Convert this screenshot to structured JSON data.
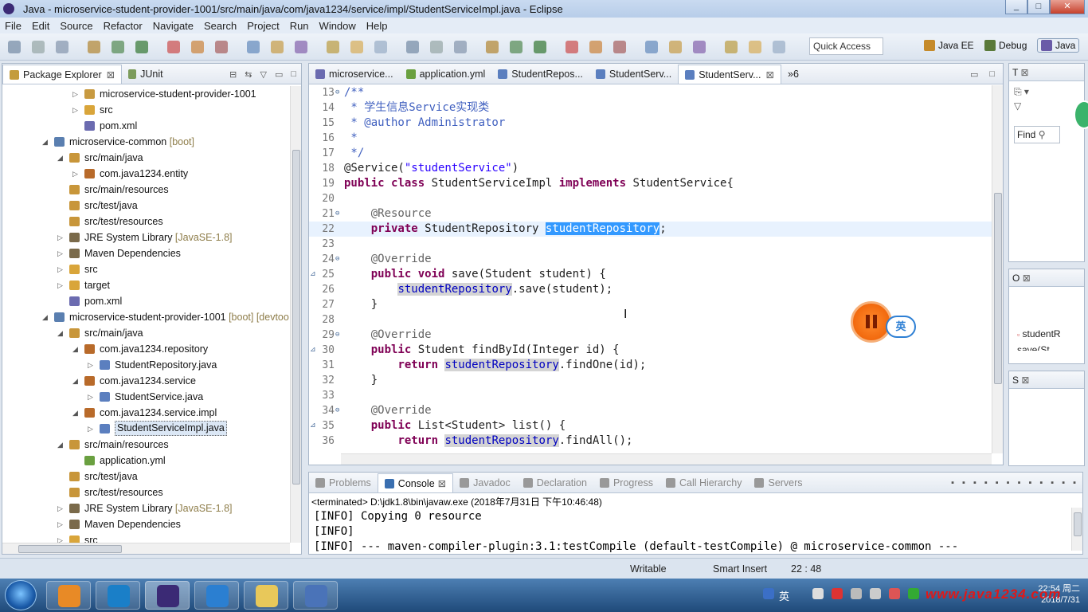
{
  "window": {
    "title": "Java - microservice-student-provider-1001/src/main/java/com/java1234/service/impl/StudentServiceImpl.java - Eclipse",
    "app_icon": "eclipse-icon"
  },
  "menu": [
    "File",
    "Edit",
    "Source",
    "Refactor",
    "Navigate",
    "Search",
    "Project",
    "Run",
    "Window",
    "Help"
  ],
  "toolbar": {
    "quick_access": "Quick Access",
    "perspectives": [
      {
        "label": "Java EE",
        "icon": "java-ee-icon"
      },
      {
        "label": "Debug",
        "icon": "debug-icon"
      },
      {
        "label": "Java",
        "icon": "java-perspective-icon",
        "active": true
      }
    ]
  },
  "package_explorer": {
    "tabs": [
      {
        "label": "Package Explorer",
        "active": true
      },
      {
        "label": "JUnit"
      }
    ],
    "rows": [
      {
        "indent": 3,
        "twisty": "▷",
        "icon": "package-folder",
        "text": "microservice-student-provider-1001",
        "deco": ""
      },
      {
        "indent": 3,
        "twisty": "▷",
        "icon": "folder",
        "text": "src",
        "deco": ""
      },
      {
        "indent": 3,
        "twisty": "",
        "icon": "pom",
        "text": "pom.xml",
        "deco": ""
      },
      {
        "indent": 1,
        "twisty": "◢",
        "icon": "project",
        "text": "microservice-common",
        "deco": " [boot]"
      },
      {
        "indent": 2,
        "twisty": "◢",
        "icon": "src-folder",
        "text": "src/main/java",
        "deco": ""
      },
      {
        "indent": 3,
        "twisty": "▷",
        "icon": "package",
        "text": "com.java1234.entity",
        "deco": ""
      },
      {
        "indent": 2,
        "twisty": "",
        "icon": "src-folder",
        "text": "src/main/resources",
        "deco": ""
      },
      {
        "indent": 2,
        "twisty": "",
        "icon": "src-folder",
        "text": "src/test/java",
        "deco": ""
      },
      {
        "indent": 2,
        "twisty": "",
        "icon": "src-folder",
        "text": "src/test/resources",
        "deco": ""
      },
      {
        "indent": 2,
        "twisty": "▷",
        "icon": "library",
        "text": "JRE System Library",
        "deco": " [JavaSE-1.8]"
      },
      {
        "indent": 2,
        "twisty": "▷",
        "icon": "library",
        "text": "Maven Dependencies",
        "deco": ""
      },
      {
        "indent": 2,
        "twisty": "▷",
        "icon": "folder",
        "text": "src",
        "deco": ""
      },
      {
        "indent": 2,
        "twisty": "▷",
        "icon": "folder",
        "text": "target",
        "deco": ""
      },
      {
        "indent": 2,
        "twisty": "",
        "icon": "pom",
        "text": "pom.xml",
        "deco": ""
      },
      {
        "indent": 1,
        "twisty": "◢",
        "icon": "project",
        "text": "microservice-student-provider-1001",
        "deco": " [boot] [devtoo"
      },
      {
        "indent": 2,
        "twisty": "◢",
        "icon": "src-folder",
        "text": "src/main/java",
        "deco": ""
      },
      {
        "indent": 3,
        "twisty": "◢",
        "icon": "package",
        "text": "com.java1234.repository",
        "deco": ""
      },
      {
        "indent": 4,
        "twisty": "▷",
        "icon": "java-file",
        "text": "StudentRepository.java",
        "deco": ""
      },
      {
        "indent": 3,
        "twisty": "◢",
        "icon": "package",
        "text": "com.java1234.service",
        "deco": ""
      },
      {
        "indent": 4,
        "twisty": "▷",
        "icon": "java-file",
        "text": "StudentService.java",
        "deco": ""
      },
      {
        "indent": 3,
        "twisty": "◢",
        "icon": "package",
        "text": "com.java1234.service.impl",
        "deco": ""
      },
      {
        "indent": 4,
        "twisty": "▷",
        "icon": "java-file",
        "text": "StudentServiceImpl.java",
        "deco": "",
        "selected": true
      },
      {
        "indent": 2,
        "twisty": "◢",
        "icon": "src-folder",
        "text": "src/main/resources",
        "deco": ""
      },
      {
        "indent": 3,
        "twisty": "",
        "icon": "yml",
        "text": "application.yml",
        "deco": ""
      },
      {
        "indent": 2,
        "twisty": "",
        "icon": "src-folder",
        "text": "src/test/java",
        "deco": ""
      },
      {
        "indent": 2,
        "twisty": "",
        "icon": "src-folder",
        "text": "src/test/resources",
        "deco": ""
      },
      {
        "indent": 2,
        "twisty": "▷",
        "icon": "library",
        "text": "JRE System Library",
        "deco": " [JavaSE-1.8]"
      },
      {
        "indent": 2,
        "twisty": "▷",
        "icon": "library",
        "text": "Maven Dependencies",
        "deco": ""
      },
      {
        "indent": 2,
        "twisty": "▷",
        "icon": "folder",
        "text": "src",
        "deco": ""
      }
    ]
  },
  "editor": {
    "tabs": [
      {
        "label": "microservice...",
        "icon": "pom"
      },
      {
        "label": "application.yml",
        "icon": "yml"
      },
      {
        "label": "StudentRepos...",
        "icon": "java-file"
      },
      {
        "label": "StudentServ...",
        "icon": "java-file"
      },
      {
        "label": "StudentServ...",
        "icon": "java-file",
        "active": true
      }
    ],
    "overflow": "»6",
    "lines": [
      {
        "n": "13",
        "m": "⊖",
        "parts": [
          [
            "cmt",
            "/**"
          ]
        ]
      },
      {
        "n": "14",
        "parts": [
          [
            "cmt",
            " * 学生信息Service实现类"
          ]
        ]
      },
      {
        "n": "15",
        "parts": [
          [
            "cmt",
            " * @author Administrator"
          ]
        ]
      },
      {
        "n": "16",
        "parts": [
          [
            "cmt",
            " *"
          ]
        ]
      },
      {
        "n": "17",
        "parts": [
          [
            "cmt",
            " */"
          ]
        ]
      },
      {
        "n": "18",
        "parts": [
          [
            "",
            "@Service("
          ],
          [
            "str",
            "\"studentService\""
          ],
          [
            "",
            ")"
          ]
        ]
      },
      {
        "n": "19",
        "parts": [
          [
            "kw",
            "public"
          ],
          [
            "",
            " "
          ],
          [
            "kw",
            "class"
          ],
          [
            "",
            " StudentServiceImpl "
          ],
          [
            "kw",
            "implements"
          ],
          [
            "",
            " StudentService{"
          ]
        ]
      },
      {
        "n": "20",
        "parts": [
          [
            "",
            ""
          ]
        ]
      },
      {
        "n": "21",
        "m": "⊖",
        "parts": [
          [
            "ann",
            "    @Resource"
          ]
        ]
      },
      {
        "n": "22",
        "cur": true,
        "parts": [
          [
            "",
            "    "
          ],
          [
            "kw",
            "private"
          ],
          [
            "",
            " StudentRepository "
          ],
          [
            "sel2",
            "studentRepository"
          ],
          [
            "",
            ";"
          ]
        ]
      },
      {
        "n": "23",
        "parts": [
          [
            "",
            ""
          ]
        ]
      },
      {
        "n": "24",
        "m": "⊖",
        "parts": [
          [
            "ann",
            "    @Override"
          ]
        ]
      },
      {
        "n": "25",
        "o": "⊿",
        "parts": [
          [
            "",
            "    "
          ],
          [
            "kw",
            "public"
          ],
          [
            "",
            " "
          ],
          [
            "kw",
            "void"
          ],
          [
            "",
            " save(Student student) {"
          ]
        ]
      },
      {
        "n": "26",
        "parts": [
          [
            "",
            "        "
          ],
          [
            "fld hl",
            "studentRepository"
          ],
          [
            "",
            ".save(student);"
          ]
        ]
      },
      {
        "n": "27",
        "parts": [
          [
            "",
            "    }"
          ]
        ]
      },
      {
        "n": "28",
        "parts": [
          [
            "",
            ""
          ]
        ]
      },
      {
        "n": "29",
        "m": "⊖",
        "parts": [
          [
            "ann",
            "    @Override"
          ]
        ]
      },
      {
        "n": "30",
        "o": "⊿",
        "parts": [
          [
            "",
            "    "
          ],
          [
            "kw",
            "public"
          ],
          [
            "",
            " Student findById(Integer id) {"
          ]
        ]
      },
      {
        "n": "31",
        "parts": [
          [
            "",
            "        "
          ],
          [
            "kw",
            "return"
          ],
          [
            "",
            " "
          ],
          [
            "fld hl",
            "studentRepository"
          ],
          [
            "",
            ".findOne(id);"
          ]
        ]
      },
      {
        "n": "32",
        "parts": [
          [
            "",
            "    }"
          ]
        ]
      },
      {
        "n": "33",
        "parts": [
          [
            "",
            ""
          ]
        ]
      },
      {
        "n": "34",
        "m": "⊖",
        "parts": [
          [
            "ann",
            "    @Override"
          ]
        ]
      },
      {
        "n": "35",
        "o": "⊿",
        "parts": [
          [
            "",
            "    "
          ],
          [
            "kw",
            "public"
          ],
          [
            "",
            " List<Student> list() {"
          ]
        ]
      },
      {
        "n": "36",
        "parts": [
          [
            "",
            "        "
          ],
          [
            "kw",
            "return"
          ],
          [
            "",
            " "
          ],
          [
            "fld hl",
            "studentRepository"
          ],
          [
            "",
            ".findAll();"
          ]
        ]
      }
    ]
  },
  "console": {
    "tabs": [
      {
        "label": "Problems",
        "icon": "problems-icon"
      },
      {
        "label": "Console",
        "icon": "console-icon",
        "active": true
      },
      {
        "label": "Javadoc",
        "icon": "javadoc-icon"
      },
      {
        "label": "Declaration",
        "icon": "declaration-icon"
      },
      {
        "label": "Progress",
        "icon": "progress-icon"
      },
      {
        "label": "Call Hierarchy",
        "icon": "call-hierarchy-icon"
      },
      {
        "label": "Servers",
        "icon": "servers-icon"
      }
    ],
    "header": "<terminated> D:\\jdk1.8\\bin\\javaw.exe (2018年7月31日 下午10:46:48)",
    "lines": [
      "[INFO] Copying 0 resource",
      "[INFO]",
      "[INFO] --- maven-compiler-plugin:3.1:testCompile (default-testCompile) @ microservice-common ---"
    ]
  },
  "right_panels": {
    "task": {
      "tab": "T",
      "find": "Find"
    },
    "outline": {
      "tab": "O",
      "items": [
        "studentR",
        "save(St"
      ]
    },
    "servers": {
      "tab": "S"
    }
  },
  "status": {
    "writable": "Writable",
    "insert": "Smart Insert",
    "position": "22 : 48"
  },
  "overlay": {
    "ime_label": "英"
  },
  "taskbar": {
    "apps": [
      "browser",
      "app-red",
      "eclipse",
      "wps",
      "explorer",
      "media"
    ],
    "ime": "英",
    "watermark": "www.java1234.com",
    "time": "22:54 周二",
    "date": "2018/7/31"
  }
}
